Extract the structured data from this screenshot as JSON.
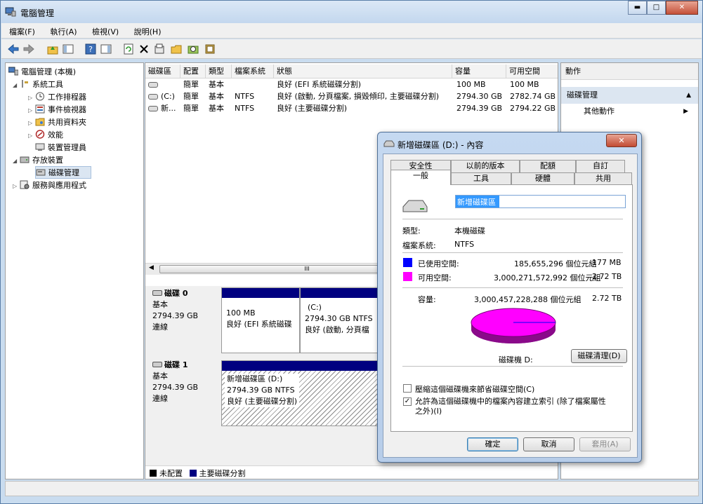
{
  "window": {
    "title": "電腦管理"
  },
  "caption": {
    "min": "▬",
    "max": "□",
    "close": "✕"
  },
  "menu": [
    "檔案(F)",
    "執行(A)",
    "檢視(V)",
    "說明(H)"
  ],
  "tree": {
    "root": "電腦管理 (本機)",
    "items": [
      {
        "label": "系統工具",
        "level": 1,
        "exp": "◢"
      },
      {
        "label": "工作排程器",
        "level": 2,
        "exp": "▷"
      },
      {
        "label": "事件檢視器",
        "level": 2,
        "exp": "▷"
      },
      {
        "label": "共用資料夾",
        "level": 2,
        "exp": "▷"
      },
      {
        "label": "效能",
        "level": 2,
        "exp": "▷"
      },
      {
        "label": "裝置管理員",
        "level": 2,
        "exp": ""
      },
      {
        "label": "存放裝置",
        "level": 1,
        "exp": "◢"
      },
      {
        "label": "磁碟管理",
        "level": 2,
        "exp": ""
      },
      {
        "label": "服務與應用程式",
        "level": 1,
        "exp": "▷"
      }
    ]
  },
  "volumes": {
    "headers": [
      "磁碟區",
      "配置",
      "類型",
      "檔案系統",
      "狀態",
      "容量",
      "可用空間"
    ],
    "rows": [
      [
        "",
        "簡單",
        "基本",
        "",
        "良好 (EFI 系統磁碟分割)",
        "100 MB",
        "100 MB"
      ],
      [
        "(C:)",
        "簡單",
        "基本",
        "NTFS",
        "良好 (啟動, 分頁檔案, 損毀傾印, 主要磁碟分割)",
        "2794.30 GB",
        "2782.74 GB"
      ],
      [
        "新...",
        "簡單",
        "基本",
        "NTFS",
        "良好 (主要磁碟分割)",
        "2794.39 GB",
        "2794.22 GB"
      ]
    ],
    "scroll_mark": "III"
  },
  "disks": [
    {
      "name": "磁碟 0",
      "type": "基本",
      "size": "2794.39 GB",
      "status": "連線",
      "parts": [
        {
          "lines": [
            "100 MB",
            "良好 (EFI 系統磁碟"
          ]
        },
        {
          "lines": [
            "(C:)",
            "2794.30 GB NTFS",
            "良好 (啟動, 分頁檔"
          ]
        }
      ]
    },
    {
      "name": "磁碟 1",
      "type": "基本",
      "size": "2794.39 GB",
      "status": "連線",
      "parts": [
        {
          "lines": [
            "新增磁碟區 (D:)",
            "2794.39 GB NTFS",
            "良好 (主要磁碟分割)"
          ]
        }
      ]
    }
  ],
  "legend": {
    "unallocated": "未配置",
    "primary": "主要磁碟分割"
  },
  "actions": {
    "header": "動作",
    "section": "磁碟管理",
    "item": "其他動作"
  },
  "dialog": {
    "title": "新增磁碟區 (D:) - 內容",
    "close": "✕",
    "tabs_top": [
      "安全性",
      "以前的版本",
      "配額",
      "自訂"
    ],
    "tabs_bottom": [
      "一般",
      "工具",
      "硬體",
      "共用"
    ],
    "volume_name": "新增磁碟區",
    "type_label": "類型:",
    "type_value": "本機磁碟",
    "fs_label": "檔案系統:",
    "fs_value": "NTFS",
    "used_label": "已使用空間:",
    "used_bytes": "185,655,296 個位元組",
    "used_size": "177 MB",
    "free_label": "可用空間:",
    "free_bytes": "3,000,271,572,992 個位元組",
    "free_size": "2.72 TB",
    "cap_label": "容量:",
    "cap_bytes": "3,000,457,228,288 個位元組",
    "cap_size": "2.72 TB",
    "drive_label": "磁碟機 D:",
    "cleanup": "磁碟清理(D)",
    "compress": "壓縮這個磁碟機來節省磁碟空間(C)",
    "index": "允許為這個磁碟機中的檔案內容建立索引 (除了檔案屬性之外)(I)",
    "ok": "確定",
    "cancel": "取消",
    "apply": "套用(A)",
    "used_color": "#0000ff",
    "free_color": "#ff00ff"
  }
}
